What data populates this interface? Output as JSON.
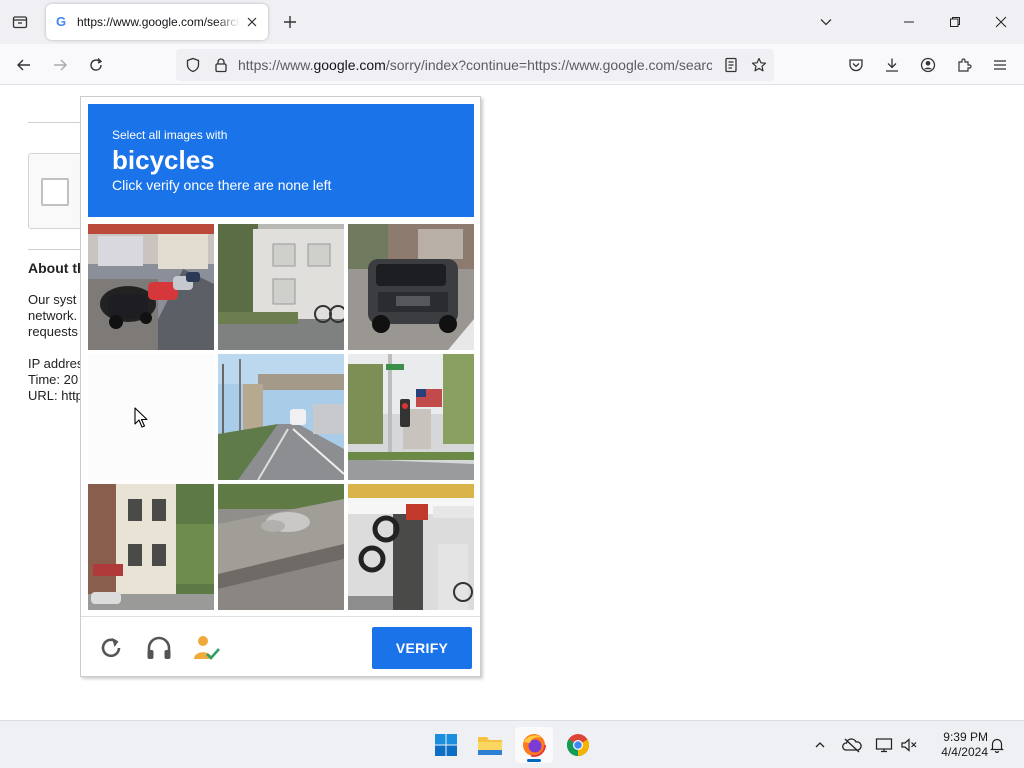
{
  "browser": {
    "tab": {
      "title": "https://www.google.com/search",
      "favicon": "G"
    },
    "url": {
      "prefix": "https://www.",
      "host": "google.com",
      "path": "/sorry/index?continue=https://www.google.com/search"
    },
    "icons": [
      "tab-list-icon",
      "close-icon",
      "plus-icon",
      "chevron-down-icon",
      "minimize-icon",
      "restore-icon",
      "close-window-icon",
      "back-icon",
      "forward-icon",
      "reload-icon",
      "shield-icon",
      "lock-icon",
      "reader-view-icon",
      "star-icon",
      "pocket-icon",
      "download-icon",
      "account-icon",
      "extensions-icon",
      "menu-icon"
    ]
  },
  "page": {
    "heading": "About th",
    "lines": [
      "Our syst",
      "network.",
      "requests"
    ],
    "ip_line": "IP addres",
    "time_line": "Time: 20",
    "url_line": "URL: http"
  },
  "captcha": {
    "header_small": "Select all images with",
    "header_big": "bicycles",
    "header_sub": "Click verify once there are none left",
    "verify_label": "VERIFY",
    "accent": "#1a73e8",
    "tiles": [
      "street-parked-cars",
      "building-with-bicycle",
      "pickup-truck",
      "blank-tile",
      "road-with-footbridge",
      "traffic-light-flag",
      "row-houses",
      "sidewalk",
      "garage-with-tires"
    ],
    "footer_icons": [
      "reload-icon",
      "headphones-icon",
      "info-person-icon"
    ]
  },
  "taskbar": {
    "apps": [
      "windows-start-icon",
      "file-explorer-icon",
      "firefox-icon",
      "chrome-icon"
    ],
    "tray": [
      "chevron-up-icon",
      "onedrive-icon",
      "display-icon",
      "volume-muted-icon",
      "notification-bell-icon"
    ],
    "time": "9:39 PM",
    "date": "4/4/2024"
  }
}
